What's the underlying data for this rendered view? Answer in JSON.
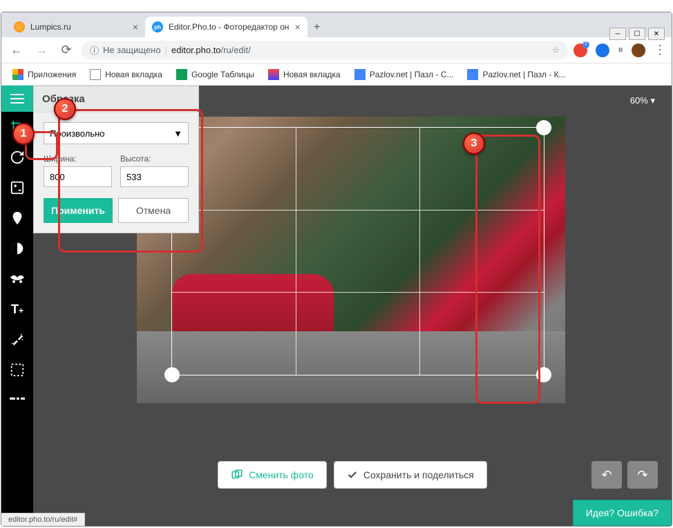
{
  "window": {
    "tabs": [
      {
        "title": "Lumpics.ru",
        "favicon": "orange"
      },
      {
        "title": "Editor.Pho.to - Фоторедактор он",
        "favicon": "pho",
        "active": true
      }
    ]
  },
  "address": {
    "security_label": "Не защищено",
    "url_host": "editor.pho.to",
    "url_path": "/ru/edit/"
  },
  "bookmarks": {
    "apps": "Приложения",
    "items": [
      "Новая вкладка",
      "Google Таблицы",
      "Новая вкладка",
      "Pazlov.net | Пазл - С...",
      "Pazlov.net | Пазл - К..."
    ]
  },
  "editor": {
    "zoom": "60%",
    "crop_panel": {
      "title": "Обрезка",
      "mode": "Произвольно",
      "width_label": "Ширина:",
      "width_value": "800",
      "height_label": "Высота:",
      "height_value": "533",
      "apply": "Применить",
      "cancel": "Отмена"
    },
    "actions": {
      "change_photo": "Сменить фото",
      "save_share": "Сохранить и поделиться"
    },
    "feedback": "Идея? Ошибка?"
  },
  "status_bar": "editor.pho.to/ru/edit#",
  "markers": {
    "m1": "1",
    "m2": "2",
    "m3": "3"
  },
  "tool_icons": {
    "crop": "crop",
    "rotate": "rotate",
    "exposure": "exposure",
    "colors": "colors",
    "sharpen": "sharpen",
    "sticker": "sticker",
    "text": "text",
    "effects": "effects",
    "frame": "frame",
    "more": "more"
  }
}
